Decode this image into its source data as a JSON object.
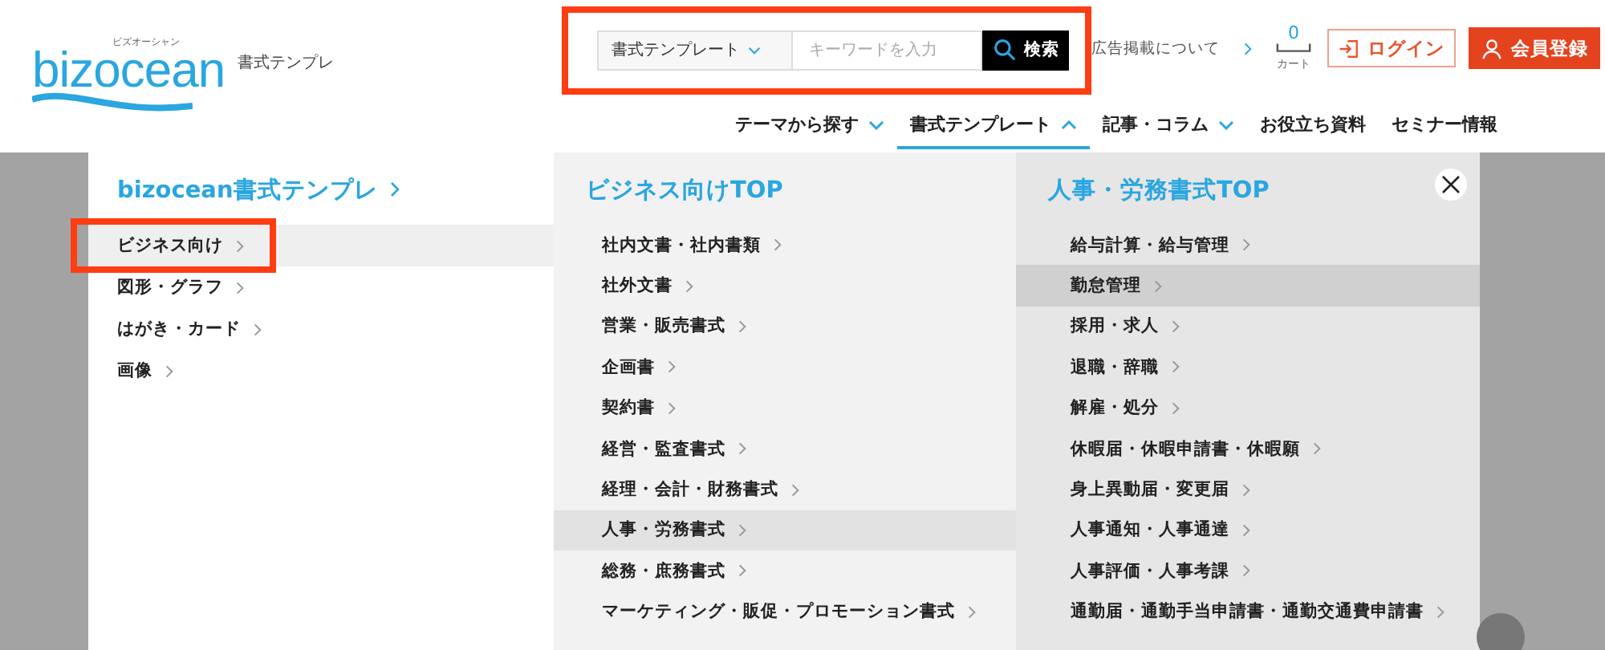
{
  "logo": {
    "ruby": "ビズオーシャン",
    "wordmark": "bizocean",
    "subtitle": "書式テンプレ"
  },
  "search": {
    "highlighted": true,
    "category": "書式テンプレート",
    "placeholder": "キーワードを入力",
    "button": "検索"
  },
  "ad_link": "広告掲載について",
  "cart": {
    "count": "0",
    "label": "カート"
  },
  "login": "ログイン",
  "register": "会員登録",
  "nav": [
    {
      "label": "テーマから探す",
      "expandable": true,
      "selected": false
    },
    {
      "label": "書式テンプレート",
      "expandable": true,
      "selected": true
    },
    {
      "label": "記事・コラム",
      "expandable": true,
      "selected": false
    },
    {
      "label": "お役立ち資料",
      "expandable": false,
      "selected": false
    },
    {
      "label": "セミナー情報",
      "expandable": false,
      "selected": false
    }
  ],
  "menu": {
    "left": {
      "title": "bizocean書式テンプレ",
      "items": [
        {
          "label": "ビジネス向け",
          "selected": true,
          "highlighted": true
        },
        {
          "label": "図形・グラフ",
          "selected": false,
          "highlighted": false
        },
        {
          "label": "はがき・カード",
          "selected": false,
          "highlighted": false
        },
        {
          "label": "画像",
          "selected": false,
          "highlighted": false
        }
      ]
    },
    "middle": {
      "title": "ビジネス向けTOP",
      "items": [
        {
          "label": "社内文書・社内書類",
          "selected": false
        },
        {
          "label": "社外文書",
          "selected": false
        },
        {
          "label": "営業・販売書式",
          "selected": false
        },
        {
          "label": "企画書",
          "selected": false
        },
        {
          "label": "契約書",
          "selected": false
        },
        {
          "label": "経営・監査書式",
          "selected": false
        },
        {
          "label": "経理・会計・財務書式",
          "selected": false
        },
        {
          "label": "人事・労務書式",
          "selected": true
        },
        {
          "label": "総務・庶務書式",
          "selected": false
        },
        {
          "label": "マーケティング・販促・プロモーション書式",
          "selected": false
        }
      ]
    },
    "right": {
      "title": "人事・労務書式TOP",
      "items": [
        {
          "label": "給与計算・給与管理",
          "selected": false
        },
        {
          "label": "勤怠管理",
          "selected": true
        },
        {
          "label": "採用・求人",
          "selected": false
        },
        {
          "label": "退職・辞職",
          "selected": false
        },
        {
          "label": "解雇・処分",
          "selected": false
        },
        {
          "label": "休暇届・休暇申請書・休暇願",
          "selected": false
        },
        {
          "label": "身上異動届・変更届",
          "selected": false
        },
        {
          "label": "人事通知・人事通達",
          "selected": false
        },
        {
          "label": "人事評価・人事考課",
          "selected": false
        },
        {
          "label": "通勤届・通勤手当申請書・通勤交通費申請書",
          "selected": false
        }
      ]
    }
  }
}
